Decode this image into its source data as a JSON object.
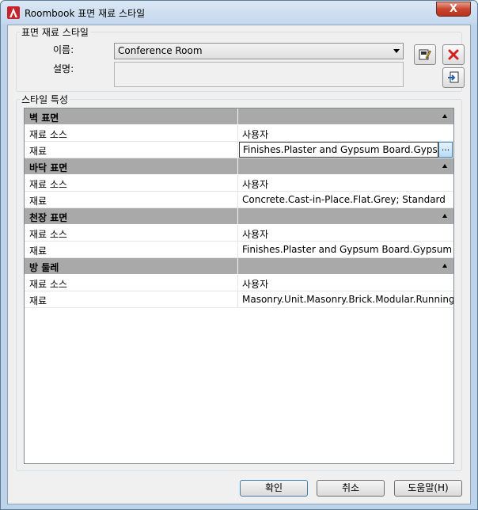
{
  "window": {
    "title": "Roombook 표면 재료 스타일",
    "close_label": "X"
  },
  "style_group": {
    "legend": "표면 재료 스타일",
    "name_label": "이름:",
    "name_value": "Conference Room",
    "desc_label": "설명:",
    "desc_value": "",
    "icons": [
      "edit-style-icon",
      "delete-icon",
      "import-style-icon"
    ]
  },
  "props_group": {
    "legend": "스타일 특성",
    "categories": [
      {
        "title": "벽 표면",
        "rows": [
          {
            "label": "재료 소스",
            "value": "사용자"
          },
          {
            "label": "재료",
            "value": "Finishes.Plaster and Gypsum Board.Gypsum Wall"
          }
        ]
      },
      {
        "title": "바닥 표면",
        "rows": [
          {
            "label": "재료 소스",
            "value": "사용자"
          },
          {
            "label": "재료",
            "value": "Concrete.Cast-in-Place.Flat.Grey; Standard"
          }
        ]
      },
      {
        "title": "천장 표면",
        "rows": [
          {
            "label": "재료 소스",
            "value": "사용자"
          },
          {
            "label": "재료",
            "value": "Finishes.Plaster and Gypsum Board.Gypsum Wall"
          }
        ]
      },
      {
        "title": "방 둘레",
        "rows": [
          {
            "label": "재료 소스",
            "value": "사용자"
          },
          {
            "label": "재료",
            "value": "Masonry.Unit.Masonry.Brick.Modular.Running"
          }
        ]
      }
    ],
    "ellipsis_label": "..."
  },
  "buttons": {
    "ok": "확인",
    "cancel": "취소",
    "help": "도움말(H)"
  },
  "colors": {
    "category_header": "#a9a9a9",
    "delete_red": "#d42020",
    "app_icon_red": "#c8232c"
  }
}
